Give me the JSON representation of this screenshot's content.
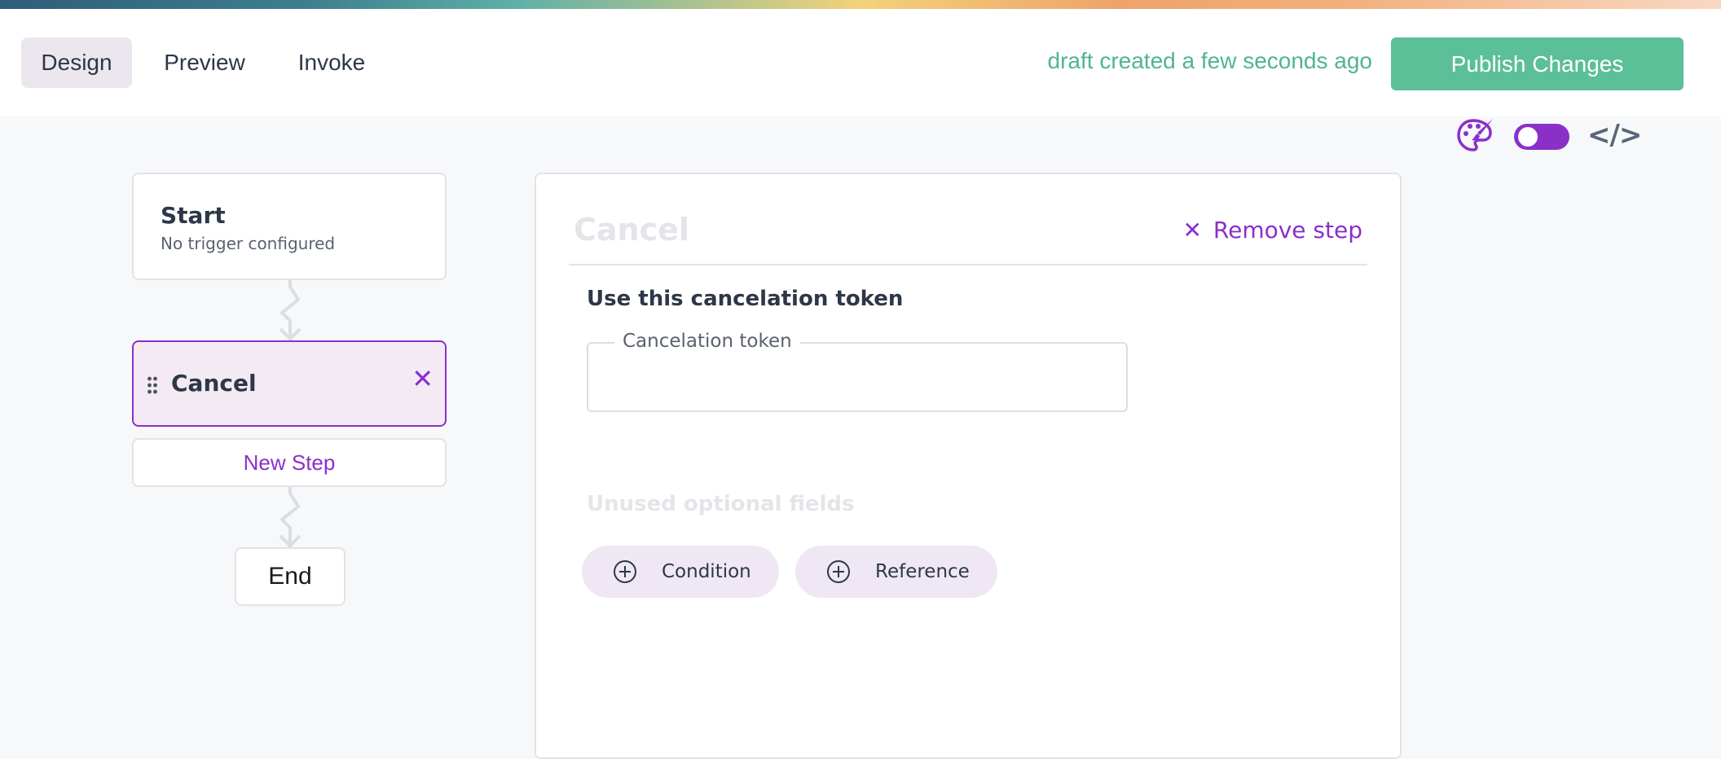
{
  "header": {
    "tabs": [
      {
        "label": "Design",
        "active": true
      },
      {
        "label": "Preview",
        "active": false
      },
      {
        "label": "Invoke",
        "active": false
      }
    ],
    "status": "draft created a few seconds ago",
    "publish_label": "Publish Changes"
  },
  "toolbar": {
    "theme_icon": "palette-icon",
    "toggle_on": true,
    "code_icon": "code-icon",
    "code_label": "</>"
  },
  "flow": {
    "start": {
      "title": "Start",
      "subtitle": "No trigger configured"
    },
    "steps": [
      {
        "title": "Cancel",
        "selected": true
      }
    ],
    "new_step_label": "New Step",
    "end_label": "End"
  },
  "panel": {
    "title": "Cancel",
    "remove_label": "Remove step",
    "section_heading": "Use this cancelation token",
    "token_label": "Cancelation token",
    "token_value": "",
    "unused_label": "Unused optional fields",
    "optional_fields": [
      "Condition",
      "Reference"
    ]
  },
  "colors": {
    "accent": "#8b2fc9",
    "publish": "#5bbf98",
    "status_text": "#4fb58f",
    "selected_bg": "#f3eaf4",
    "pill_bg": "#f0e7f4"
  }
}
